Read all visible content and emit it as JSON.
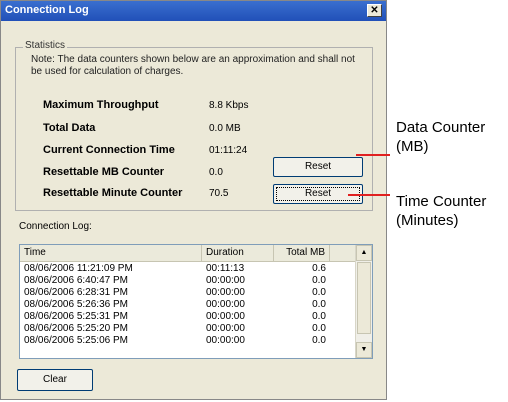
{
  "window": {
    "title": "Connection Log",
    "close_glyph": "✕"
  },
  "stats": {
    "group_label": "Statistics",
    "note": "Note: The data counters shown below are an approximation and shall not be used for calculation of charges.",
    "rows": [
      {
        "label": "Maximum Throughput",
        "value": "8.8 Kbps"
      },
      {
        "label": "Total Data",
        "value": "0.0 MB"
      },
      {
        "label": "Current Connection Time",
        "value": "01:11:24"
      },
      {
        "label": "Resettable MB Counter",
        "value": "0.0"
      },
      {
        "label": "Resettable Minute Counter",
        "value": "70.5"
      }
    ],
    "reset_label": "Reset"
  },
  "log": {
    "label": "Connection Log:",
    "columns": [
      "Time",
      "Duration",
      "Total MB"
    ],
    "rows": [
      {
        "time": "08/06/2006 11:21:09 PM",
        "duration": "00:11:13",
        "mb": "0.6"
      },
      {
        "time": "08/06/2006 6:40:47 PM",
        "duration": "00:00:00",
        "mb": "0.0"
      },
      {
        "time": "08/06/2006 6:28:31 PM",
        "duration": "00:00:00",
        "mb": "0.0"
      },
      {
        "time": "08/06/2006 5:26:36 PM",
        "duration": "00:00:00",
        "mb": "0.0"
      },
      {
        "time": "08/06/2006 5:25:31 PM",
        "duration": "00:00:00",
        "mb": "0.0"
      },
      {
        "time": "08/06/2006 5:25:20 PM",
        "duration": "00:00:00",
        "mb": "0.0"
      },
      {
        "time": "08/06/2006 5:25:06 PM",
        "duration": "00:00:00",
        "mb": "0.0"
      }
    ],
    "scroll_up": "▲",
    "scroll_down": "▼",
    "clear_label": "Clear"
  },
  "annotations": {
    "data_counter_1": "Data Counter",
    "data_counter_2": "(MB)",
    "time_counter_1": "Time Counter",
    "time_counter_2": "(Minutes)",
    "line_color": "#e02020"
  }
}
